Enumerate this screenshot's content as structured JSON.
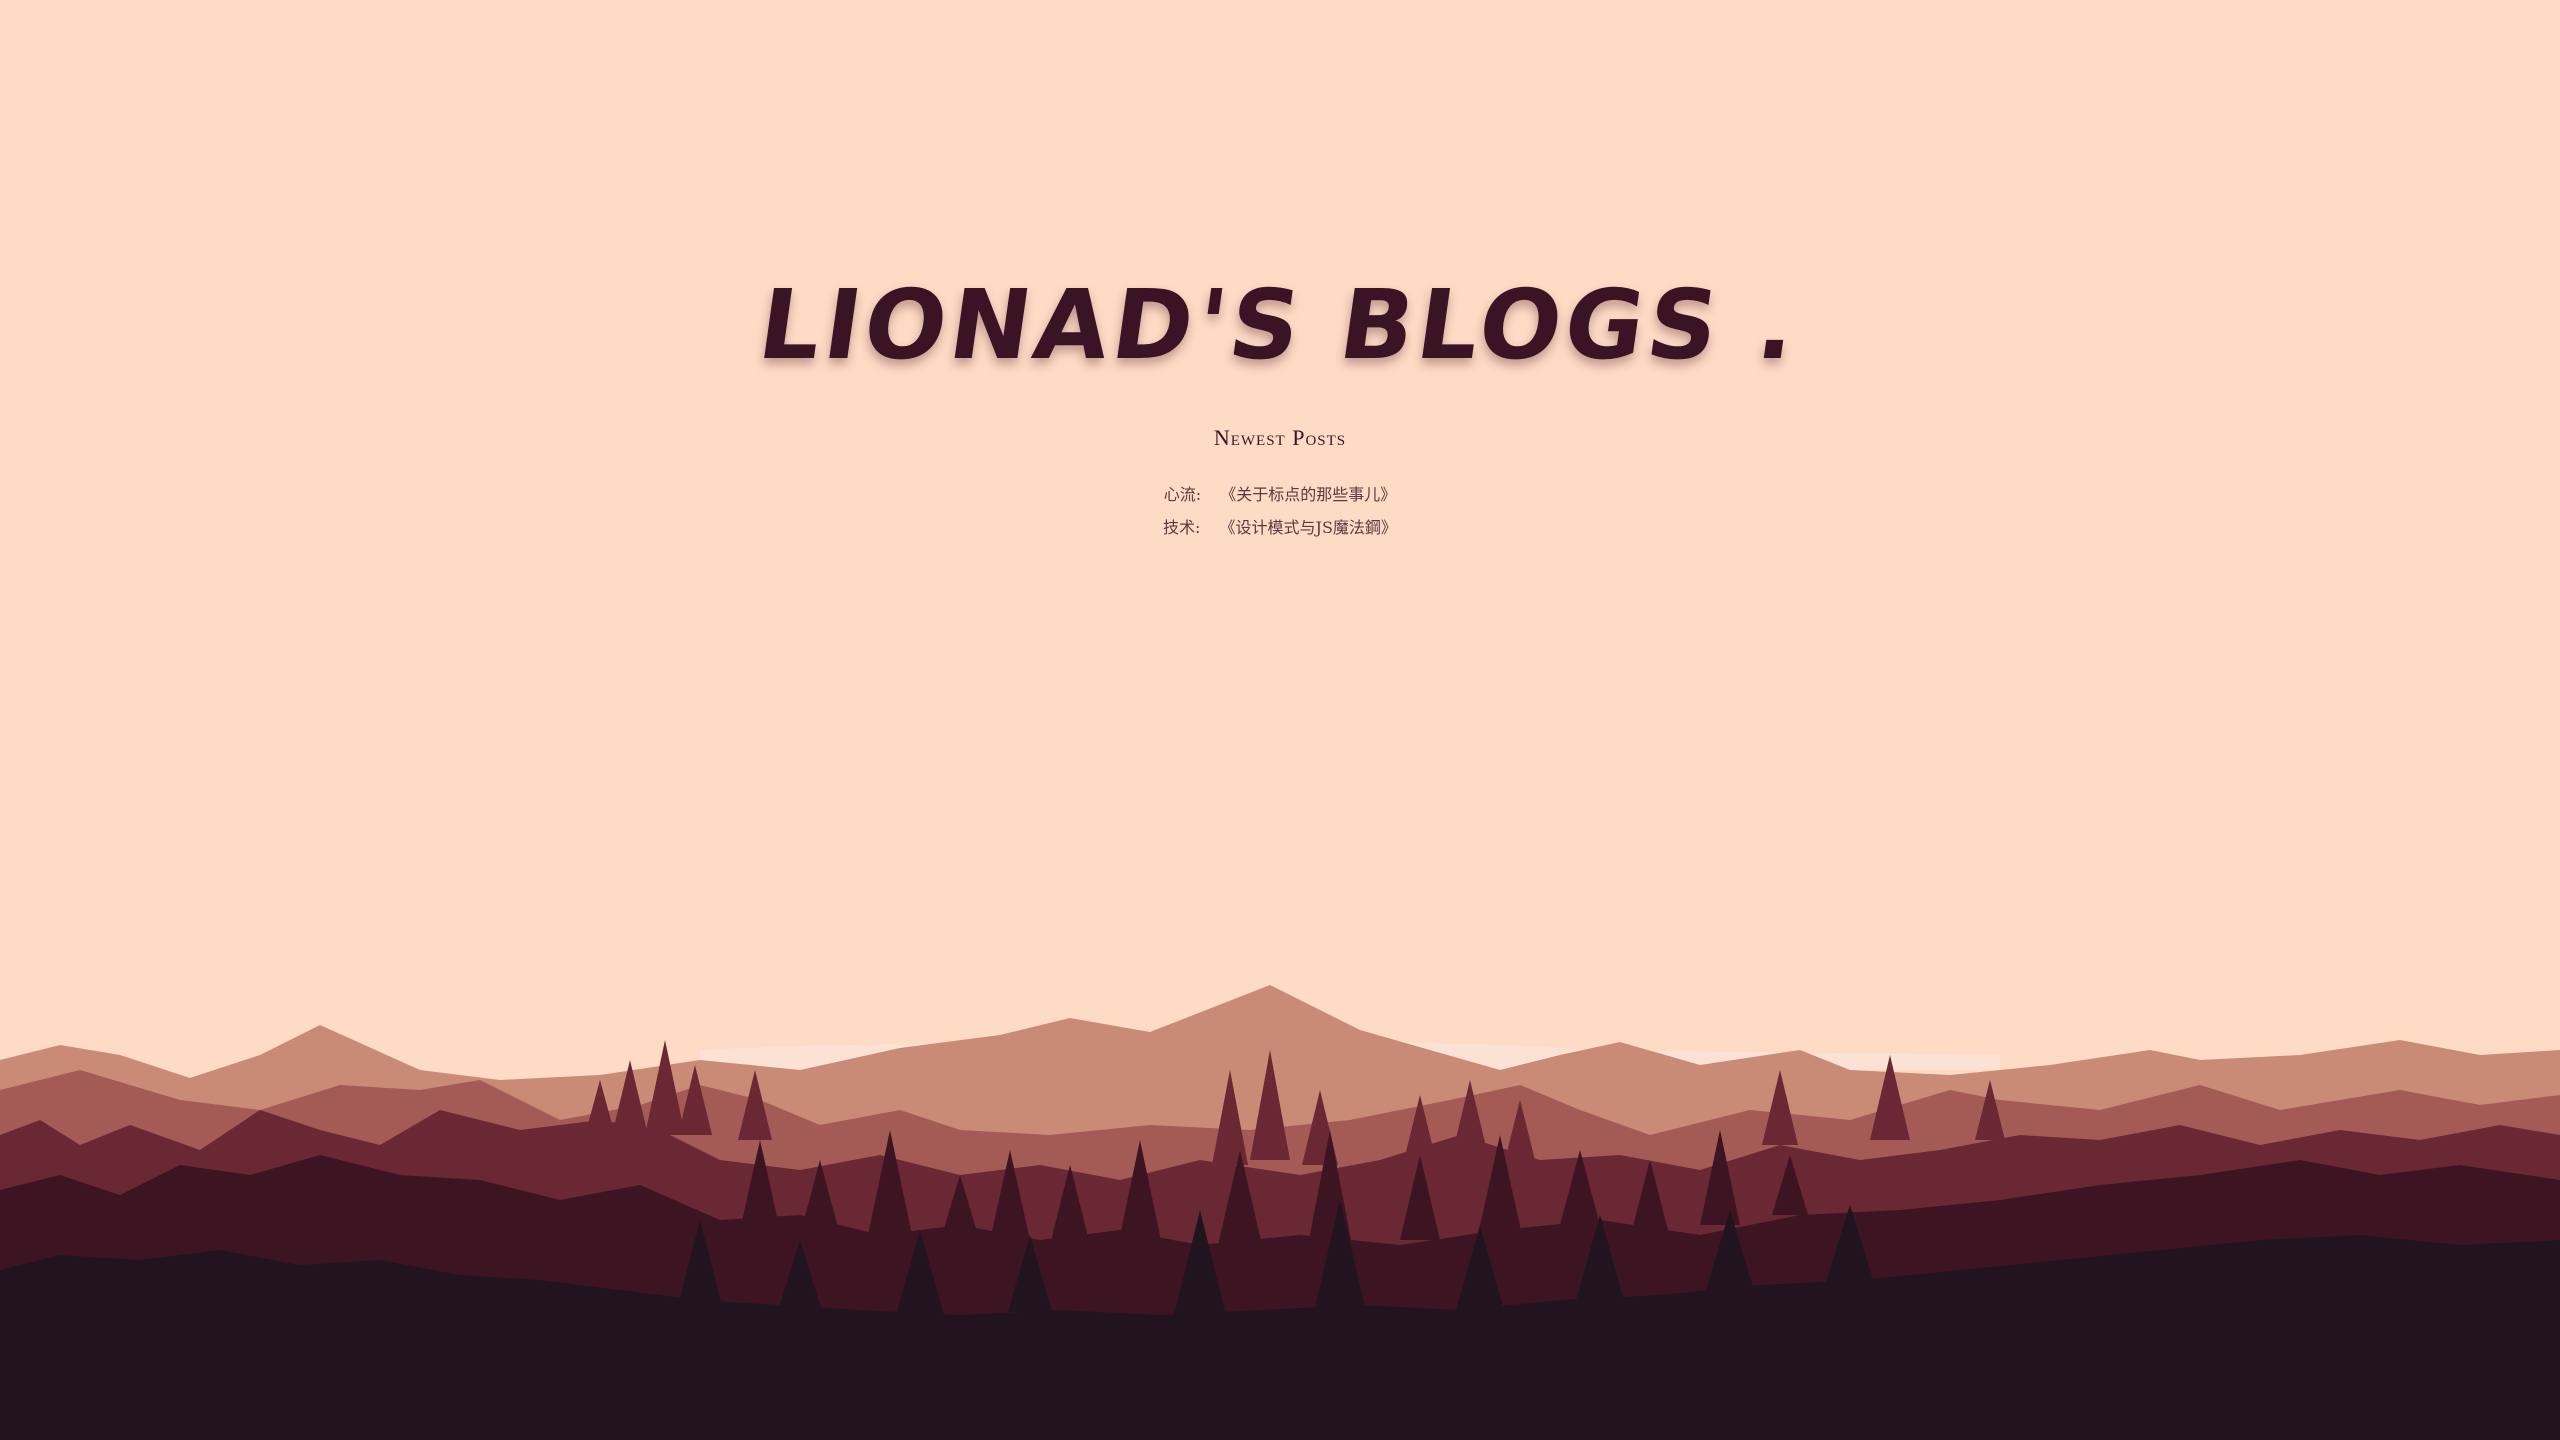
{
  "site": {
    "title": "LIONAD'S BLOGS ."
  },
  "newest_posts": {
    "heading": "Newest Posts",
    "items": [
      {
        "category": "心流:",
        "title": "《关于标点的那些事儿》"
      },
      {
        "category": "技术:",
        "title": "《设计模式与JS魔法鋼》"
      }
    ]
  },
  "colors": {
    "background": "#fedbc5",
    "title": "#3a1425",
    "mountain_far": "#c98a76",
    "mountain_mid": "#a45a55",
    "forest_mid": "#6a2834",
    "forest_near": "#3d1422",
    "forest_front": "#22141f"
  }
}
